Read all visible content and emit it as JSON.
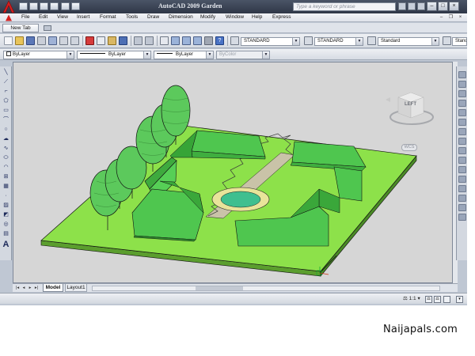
{
  "window": {
    "title": "AutoCAD 2009",
    "document": "Garden",
    "search_placeholder": "Type a keyword or phrase"
  },
  "menu": {
    "items": [
      "File",
      "Edit",
      "View",
      "Insert",
      "Format",
      "Tools",
      "Draw",
      "Dimension",
      "Modify",
      "Window",
      "Help",
      "Express"
    ]
  },
  "tabs": {
    "new_tab": "New Tab"
  },
  "styles_toolbar": {
    "text_style": "STANDARD",
    "dim_style": "STANDARD",
    "table_style": "Standard",
    "multileader_style": "Stand"
  },
  "properties_toolbar": {
    "color": "ByLayer",
    "linetype": "ByLayer",
    "lineweight": "ByLayer",
    "plot_style": "ByColor"
  },
  "viewcube": {
    "face": "LEFT",
    "ucs": "WCS"
  },
  "layout_tabs": {
    "model": "Model",
    "layout1": "Layout1"
  },
  "status": {
    "annotation_scale": "1:1"
  },
  "watermark": "Naijapals.com",
  "colors": {
    "title_bar": "#2f3747",
    "viewport_bg": "#d6d6d6",
    "ground": "#8de14a",
    "hedge": "#4cc24c",
    "tree": "#5cc95c",
    "pond_water": "#3fbf8f",
    "pond_rim": "#e8e49a"
  },
  "icons": [
    "autocad-logo",
    "new-icon",
    "open-icon",
    "save-icon",
    "print-icon",
    "undo-icon",
    "redo-icon",
    "search-icon",
    "help-icon",
    "minimize-icon",
    "maximize-icon",
    "close-icon"
  ]
}
